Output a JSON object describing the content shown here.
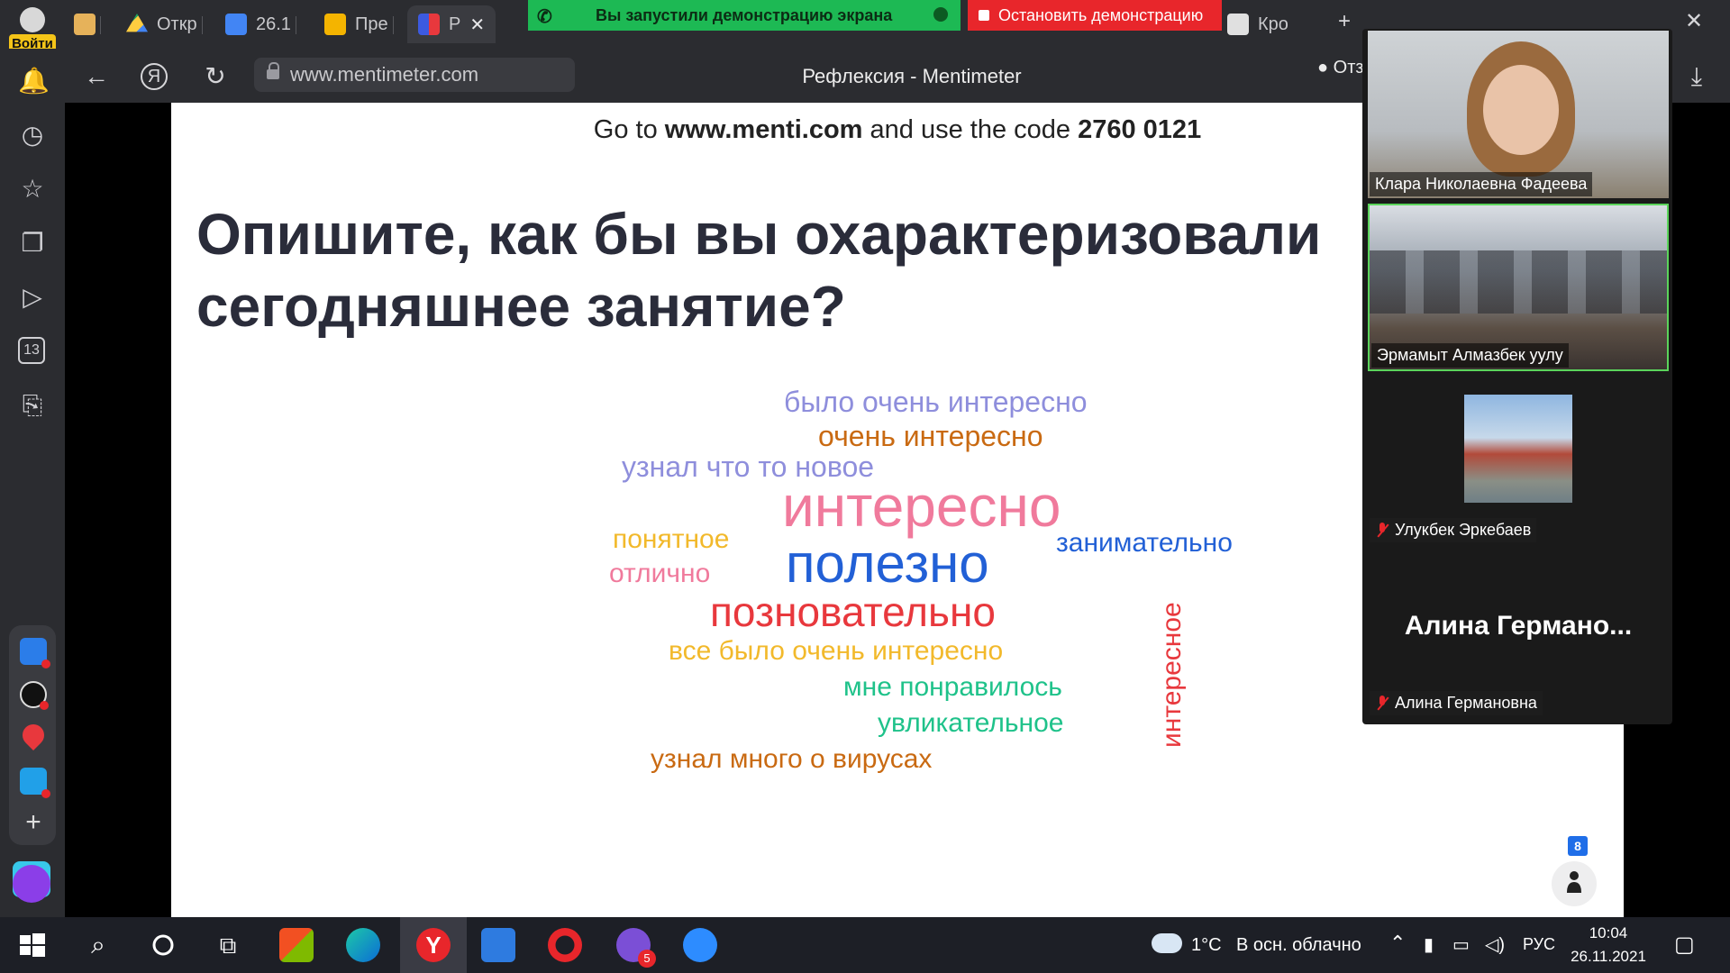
{
  "browser": {
    "login_label": "Войти",
    "tabs": [
      {
        "label": "Откр"
      },
      {
        "label": "26.1"
      },
      {
        "label": "Пре"
      },
      {
        "label": "Р"
      }
    ],
    "right_tab_label": "Кро",
    "share_banner": "Вы запустили демонстрацию экрана",
    "stop_share_label": "Остановить демонстрацию",
    "url": "www.mentimeter.com",
    "page_title": "Рефлексия - Mentimeter",
    "review_label": "Отз"
  },
  "sidebar": {
    "calendar_day": "13"
  },
  "slide": {
    "join_prefix": "Go to ",
    "join_site": "www.menti.com",
    "join_middle": " and use the code ",
    "join_code": "2760 0121",
    "question": "Опишите, как бы вы охарактеризовали сегодняшнее занятие?",
    "words": [
      {
        "text": "было очень интересно",
        "color": "#8e8edc"
      },
      {
        "text": "очень интересно",
        "color": "#c96a12"
      },
      {
        "text": "узнал что то новое",
        "color": "#8e8edc"
      },
      {
        "text": "интересно",
        "color": "#f07a9c"
      },
      {
        "text": "понятное",
        "color": "#f2b92b"
      },
      {
        "text": "полезно",
        "color": "#2260d6"
      },
      {
        "text": "занимательно",
        "color": "#2260d6"
      },
      {
        "text": "отлично",
        "color": "#f07a9c"
      },
      {
        "text": "позновательно",
        "color": "#e8383d"
      },
      {
        "text": "все было очень интересно",
        "color": "#f2b92b"
      },
      {
        "text": "мне понравилось",
        "color": "#1fc28a"
      },
      {
        "text": "увликательное",
        "color": "#1fc28a"
      },
      {
        "text": "узнал много о вирусах",
        "color": "#c96a12"
      },
      {
        "text": "интересное",
        "color": "#e8383d"
      }
    ],
    "vote_count": "8"
  },
  "video_panel": {
    "participants": [
      {
        "name": "Клара Николаевна Фадеева",
        "muted": false
      },
      {
        "name": "Эрмамыт Алмазбек уулу",
        "muted": false
      },
      {
        "name": "Улукбек Эркебаев",
        "muted": true
      },
      {
        "name": "Алина Германовна",
        "display_name": "Алина  Германо...",
        "muted": true
      }
    ]
  },
  "taskbar": {
    "weather_temp": "1°C",
    "weather_desc": "В осн. облачно",
    "language": "РУС",
    "time": "10:04",
    "date": "26.11.2021",
    "viber_badge": "5"
  }
}
